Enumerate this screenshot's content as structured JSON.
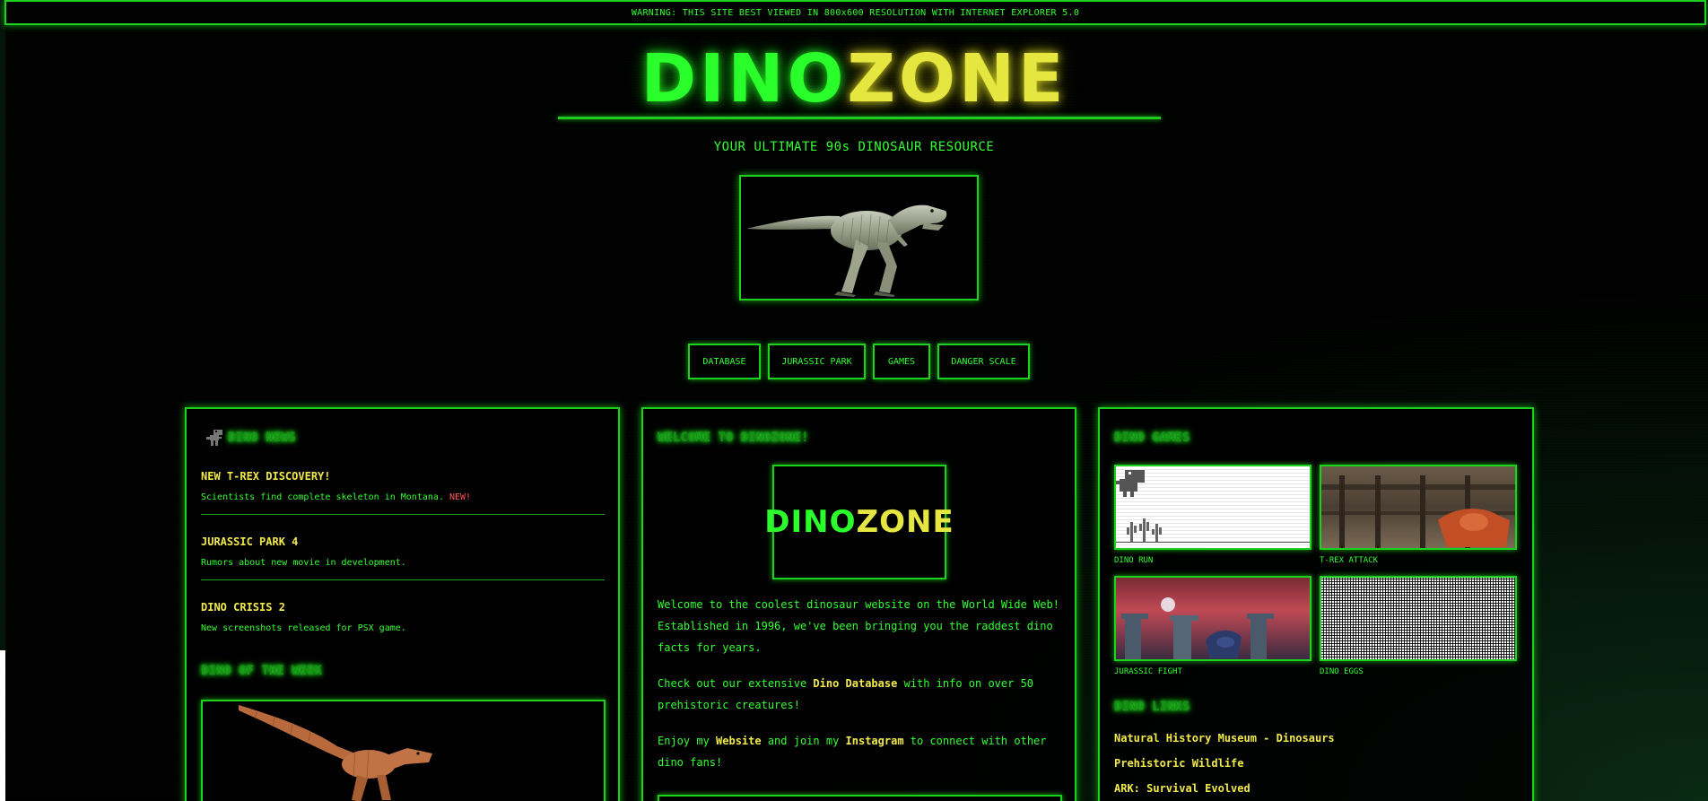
{
  "warning": "WARNING: THIS SITE BEST VIEWED IN 800x600 RESOLUTION WITH INTERNET EXPLORER 5.0",
  "logo": {
    "part1": "DINO",
    "part2": "ZONE"
  },
  "tagline": "YOUR ULTIMATE 90s DINOSAUR RESOURCE",
  "nav": [
    "DATABASE",
    "JURASSIC PARK",
    "GAMES",
    "DANGER SCALE"
  ],
  "news": {
    "title": "DINO NEWS",
    "items": [
      {
        "title": "NEW T-REX DISCOVERY!",
        "text": "Scientists find complete skeleton in Montana.",
        "badge": "NEW!"
      },
      {
        "title": "JURASSIC PARK 4",
        "text": "Rumors about new movie in development."
      },
      {
        "title": "DINO CRISIS 2",
        "text": "New screenshots released for PSX game."
      }
    ],
    "week_title": "DINO OF THE WEEK"
  },
  "welcome": {
    "title": "WELCOME TO DINOZONE!",
    "p1": "Welcome to the coolest dinosaur website on the World Wide Web! Established in 1996, we've been bringing you the raddest dino facts for years.",
    "p2_pre": "Check out our extensive ",
    "p2_link": "Dino Database",
    "p2_post": " with info on over 50 prehistoric creatures!",
    "p3_pre": "Enjoy my ",
    "p3_link1": "Website",
    "p3_mid": " and join my ",
    "p3_link2": "Instagram",
    "p3_post": " to connect with other dino fans!"
  },
  "games": {
    "title": "DINO GAMES",
    "items": [
      "DINO RUN",
      "T-REX ATTACK",
      "JURASSIC FIGHT",
      "DINO EGGS"
    ]
  },
  "links": {
    "title": "DINO LINKS",
    "items": [
      "Natural History Museum - Dinosaurs",
      "Prehistoric Wildlife",
      "ARK: Survival Evolved"
    ]
  },
  "colors": {
    "green": "#22ff22",
    "yellow": "#f2e94a",
    "red": "#ff5555"
  }
}
